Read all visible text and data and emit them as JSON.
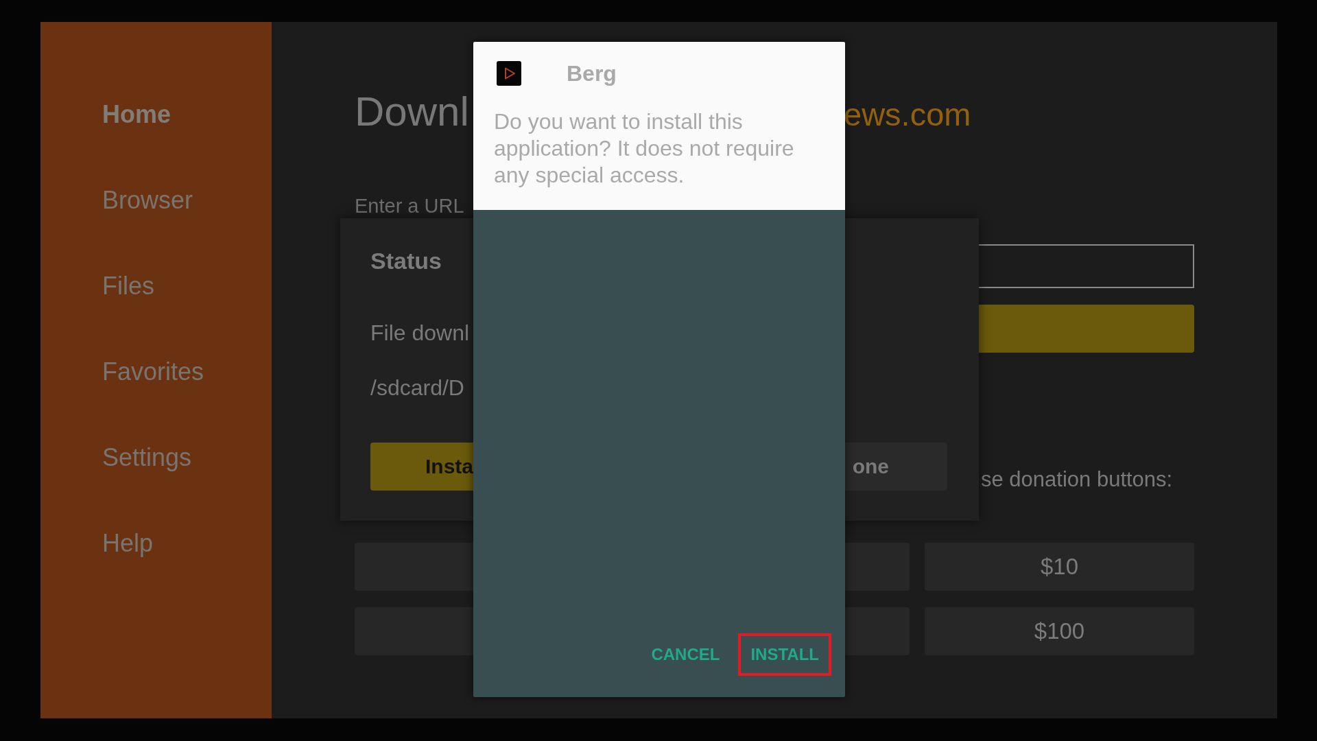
{
  "sidebar": {
    "items": [
      {
        "label": "Home",
        "selected": true
      },
      {
        "label": "Browser",
        "selected": false
      },
      {
        "label": "Files",
        "selected": false
      },
      {
        "label": "Favorites",
        "selected": false
      },
      {
        "label": "Settings",
        "selected": false
      },
      {
        "label": "Help",
        "selected": false
      }
    ]
  },
  "main": {
    "title_start": "Downl",
    "title_end": "ews.com",
    "url_label": "Enter a URL",
    "donation_text": "se donation buttons:",
    "donation_rows": [
      {
        "label": "$10"
      },
      {
        "label": "$100"
      }
    ]
  },
  "status_dialog": {
    "title": "Status",
    "lines": [
      "File downl",
      "/sdcard/D"
    ],
    "buttons": [
      {
        "label": "Insta",
        "kind": "primary"
      },
      {
        "label": "one",
        "kind": "secondary"
      }
    ]
  },
  "install_dialog": {
    "app_name": "Berg",
    "message": "Do you want to install this application? It does not require any special access.",
    "actions": [
      {
        "label": "CANCEL",
        "highlighted": false
      },
      {
        "label": "INSTALL",
        "highlighted": true
      }
    ]
  }
}
